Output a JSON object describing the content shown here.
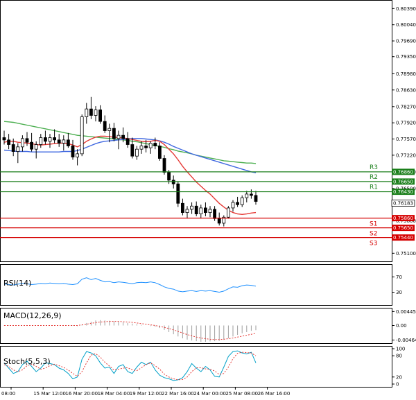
{
  "chart_data": [
    {
      "type": "candlestick",
      "title": "",
      "price_axis_ticks": [
        "0.80390",
        "0.80040",
        "0.79690",
        "0.79350",
        "0.78980",
        "0.78630",
        "0.78270",
        "0.77920",
        "0.77570",
        "0.77220",
        "0.76860",
        "0.76500",
        "0.75800",
        "0.75100"
      ],
      "ylim": [
        0.75,
        0.805
      ],
      "time_axis_labels": [
        "08:00",
        "15 Mar 12:00",
        "16 Mar 20:00",
        "18 Mar 04:00",
        "19 Mar 12:00",
        "22 Mar 16:00",
        "24 Mar 00:00",
        "25 Mar 08:00",
        "26 Mar 16:00"
      ],
      "candles": [
        [
          0.776,
          0.7775,
          0.7745,
          0.7755
        ],
        [
          0.7755,
          0.7768,
          0.7735,
          0.7745
        ],
        [
          0.7745,
          0.7758,
          0.772,
          0.773
        ],
        [
          0.773,
          0.7748,
          0.7705,
          0.774
        ],
        [
          0.774,
          0.7765,
          0.773,
          0.7758
        ],
        [
          0.7758,
          0.7772,
          0.7742,
          0.775
        ],
        [
          0.775,
          0.777,
          0.773,
          0.7735
        ],
        [
          0.7735,
          0.7752,
          0.7715,
          0.7745
        ],
        [
          0.7745,
          0.7768,
          0.7738,
          0.776
        ],
        [
          0.776,
          0.7775,
          0.7745,
          0.7752
        ],
        [
          0.7752,
          0.7768,
          0.7738,
          0.776
        ],
        [
          0.776,
          0.7778,
          0.7748,
          0.7755
        ],
        [
          0.7755,
          0.7768,
          0.774,
          0.7748
        ],
        [
          0.7748,
          0.7765,
          0.7732,
          0.7755
        ],
        [
          0.7755,
          0.777,
          0.7738,
          0.7742
        ],
        [
          0.7742,
          0.7755,
          0.7712,
          0.7718
        ],
        [
          0.7718,
          0.7735,
          0.77,
          0.7725
        ],
        [
          0.7725,
          0.781,
          0.772,
          0.7805
        ],
        [
          0.7805,
          0.7835,
          0.779,
          0.7822
        ],
        [
          0.7822,
          0.7848,
          0.78,
          0.7808
        ],
        [
          0.7808,
          0.7828,
          0.7795,
          0.782
        ],
        [
          0.782,
          0.783,
          0.779,
          0.7795
        ],
        [
          0.7795,
          0.7808,
          0.777,
          0.7775
        ],
        [
          0.7775,
          0.779,
          0.775,
          0.778
        ],
        [
          0.778,
          0.7792,
          0.7752,
          0.7758
        ],
        [
          0.7758,
          0.7775,
          0.7735,
          0.7765
        ],
        [
          0.7765,
          0.7782,
          0.775,
          0.7758
        ],
        [
          0.7758,
          0.7772,
          0.7738,
          0.7745
        ],
        [
          0.7745,
          0.776,
          0.7715,
          0.772
        ],
        [
          0.772,
          0.7742,
          0.7712,
          0.7735
        ],
        [
          0.7735,
          0.7752,
          0.7725,
          0.7742
        ],
        [
          0.7742,
          0.7755,
          0.7728,
          0.7738
        ],
        [
          0.7738,
          0.7752,
          0.7725,
          0.7748
        ],
        [
          0.7748,
          0.776,
          0.7735,
          0.7742
        ],
        [
          0.7742,
          0.775,
          0.771,
          0.7715
        ],
        [
          0.7715,
          0.7722,
          0.768,
          0.7685
        ],
        [
          0.7685,
          0.769,
          0.766,
          0.7668
        ],
        [
          0.7668,
          0.7678,
          0.765,
          0.766
        ],
        [
          0.766,
          0.7665,
          0.761,
          0.7618
        ],
        [
          0.7618,
          0.7628,
          0.7592,
          0.7598
        ],
        [
          0.7598,
          0.7612,
          0.7585,
          0.7605
        ],
        [
          0.7605,
          0.762,
          0.7595,
          0.7612
        ],
        [
          0.7612,
          0.7622,
          0.759,
          0.7595
        ],
        [
          0.7595,
          0.7615,
          0.7585,
          0.7608
        ],
        [
          0.7608,
          0.762,
          0.759,
          0.7598
        ],
        [
          0.7598,
          0.7612,
          0.7588,
          0.7605
        ],
        [
          0.7605,
          0.7612,
          0.758,
          0.7585
        ],
        [
          0.7585,
          0.7598,
          0.757,
          0.7575
        ],
        [
          0.7575,
          0.7592,
          0.7568,
          0.7588
        ],
        [
          0.7588,
          0.7612,
          0.7585,
          0.7608
        ],
        [
          0.7608,
          0.7625,
          0.76,
          0.762
        ],
        [
          0.762,
          0.7632,
          0.761,
          0.7615
        ],
        [
          0.7615,
          0.7635,
          0.761,
          0.763
        ],
        [
          0.763,
          0.7645,
          0.762,
          0.7638
        ],
        [
          0.7638,
          0.7648,
          0.7628,
          0.7635
        ],
        [
          0.7635,
          0.7645,
          0.7615,
          0.7622
        ]
      ],
      "moving_averages": [
        {
          "color": "#4caf50",
          "values": [
            0.7795,
            0.7794,
            0.7793,
            0.7791,
            0.7789,
            0.7787,
            0.7785,
            0.7783,
            0.7781,
            0.7779,
            0.7777,
            0.7775,
            0.7773,
            0.7771,
            0.7769,
            0.7767,
            0.7765,
            0.7764,
            0.7763,
            0.7762,
            0.7761,
            0.776,
            0.7759,
            0.7758,
            0.7757,
            0.7756,
            0.7755,
            0.7754,
            0.7752,
            0.7751,
            0.7749,
            0.7747,
            0.7745,
            0.7743,
            0.7741,
            0.7739,
            0.7736,
            0.7734,
            0.7731,
            0.7729,
            0.7727,
            0.7725,
            0.7722,
            0.772,
            0.7718,
            0.7716,
            0.7714,
            0.7712,
            0.771,
            0.7709,
            0.7708,
            0.7707,
            0.7706,
            0.7705,
            0.7705,
            0.7704
          ]
        },
        {
          "color": "#4169e1",
          "values": [
            0.7733,
            0.7732,
            0.7731,
            0.773,
            0.773,
            0.773,
            0.7729,
            0.7729,
            0.7729,
            0.7729,
            0.7729,
            0.7729,
            0.7729,
            0.773,
            0.773,
            0.773,
            0.7732,
            0.7735,
            0.7739,
            0.7743,
            0.7747,
            0.775,
            0.7752,
            0.7753,
            0.7754,
            0.7755,
            0.7756,
            0.7757,
            0.7758,
            0.7758,
            0.7758,
            0.7757,
            0.7756,
            0.7755,
            0.7753,
            0.775,
            0.7746,
            0.7741,
            0.7737,
            0.7733,
            0.7729,
            0.7725,
            0.7722,
            0.7719,
            0.7716,
            0.7713,
            0.771,
            0.7707,
            0.7704,
            0.7701,
            0.7698,
            0.7695,
            0.7692,
            0.7689,
            0.7686,
            0.7684
          ]
        },
        {
          "color": "#e53935",
          "values": [
            0.775,
            0.7752,
            0.7752,
            0.775,
            0.7749,
            0.7748,
            0.7747,
            0.7745,
            0.7744,
            0.7745,
            0.7746,
            0.7747,
            0.7748,
            0.7748,
            0.7747,
            0.7744,
            0.774,
            0.7745,
            0.7752,
            0.7757,
            0.7761,
            0.7763,
            0.7763,
            0.7762,
            0.7761,
            0.776,
            0.7759,
            0.7758,
            0.7756,
            0.7754,
            0.7752,
            0.7751,
            0.7752,
            0.7754,
            0.7752,
            0.7745,
            0.7735,
            0.7725,
            0.7712,
            0.7698,
            0.7686,
            0.7675,
            0.7664,
            0.7655,
            0.7646,
            0.7638,
            0.7628,
            0.7618,
            0.761,
            0.7603,
            0.7598,
            0.7595,
            0.7594,
            0.7595,
            0.7597,
            0.7598
          ]
        }
      ],
      "current_price": "0.76183"
    },
    {
      "type": "line",
      "name": "RSI(14)",
      "y_axis_ticks": [
        "70",
        "30"
      ],
      "ylim": [
        0,
        100
      ],
      "values": [
        52,
        50,
        49,
        51,
        53,
        52,
        50,
        51,
        53,
        52,
        54,
        53,
        52,
        53,
        51,
        50,
        52,
        64,
        68,
        63,
        66,
        61,
        57,
        58,
        55,
        57,
        56,
        54,
        52,
        55,
        56,
        55,
        57,
        55,
        50,
        44,
        40,
        38,
        33,
        31,
        33,
        34,
        32,
        34,
        33,
        34,
        32,
        30,
        33,
        39,
        44,
        43,
        47,
        49,
        48,
        46
      ]
    },
    {
      "type": "bar+line",
      "name": "MACD(12,26,9)",
      "y_axis_ticks": [
        "0.004451",
        "0.00",
        "-0.004646"
      ],
      "ylim": [
        -0.0052,
        0.0052
      ],
      "histogram": [
        0.0001,
        0.0001,
        0.0,
        0.0,
        0.0,
        0.0,
        0.0,
        0.0,
        0.0,
        0.0,
        0.0,
        0.0,
        0.0,
        0.0,
        0.0,
        -0.0001,
        -0.0002,
        0.0002,
        0.0008,
        0.0012,
        0.0016,
        0.0017,
        0.0016,
        0.0015,
        0.0013,
        0.0011,
        0.001,
        0.0008,
        0.0006,
        0.0004,
        0.0002,
        0.0,
        -0.0002,
        -0.0004,
        -0.0008,
        -0.0014,
        -0.0021,
        -0.0028,
        -0.0035,
        -0.0041,
        -0.0045,
        -0.0048,
        -0.005,
        -0.0052,
        -0.0052,
        -0.0051,
        -0.005,
        -0.0049,
        -0.0046,
        -0.0041,
        -0.0035,
        -0.003,
        -0.0025,
        -0.0021,
        -0.0017,
        -0.0015
      ],
      "signal": [
        0.0,
        0.0,
        0.0,
        0.0,
        0.0,
        0.0,
        0.0,
        0.0,
        0.0,
        0.0,
        0.0,
        0.0,
        0.0,
        0.0,
        0.0,
        0.0,
        0.0,
        0.0002,
        0.0004,
        0.0007,
        0.0009,
        0.0011,
        0.0012,
        0.0013,
        0.0013,
        0.0013,
        0.0012,
        0.0011,
        0.001,
        0.0008,
        0.0006,
        0.0004,
        0.0002,
        0.0,
        -0.0003,
        -0.0006,
        -0.001,
        -0.0014,
        -0.0019,
        -0.0024,
        -0.0029,
        -0.0033,
        -0.0037,
        -0.004,
        -0.0042,
        -0.0044,
        -0.0045,
        -0.0045,
        -0.0044,
        -0.0042,
        -0.004,
        -0.0037,
        -0.0034,
        -0.0031,
        -0.0028,
        -0.0025
      ]
    },
    {
      "type": "line",
      "name": "Stoch(5,5,3)",
      "y_axis_ticks": [
        "100",
        "80",
        "20",
        "0"
      ],
      "ylim": [
        0,
        100
      ],
      "series": [
        {
          "color": "#00a0c8",
          "values": [
            60,
            45,
            30,
            35,
            55,
            65,
            50,
            35,
            45,
            60,
            58,
            55,
            45,
            40,
            30,
            15,
            20,
            70,
            92,
            88,
            80,
            60,
            45,
            48,
            30,
            50,
            55,
            35,
            30,
            48,
            62,
            55,
            62,
            40,
            25,
            18,
            15,
            10,
            12,
            18,
            35,
            58,
            45,
            35,
            50,
            40,
            22,
            20,
            48,
            78,
            92,
            94,
            88,
            85,
            90,
            60
          ]
        },
        {
          "color": "#e53935",
          "values": [
            55,
            50,
            40,
            35,
            40,
            52,
            56,
            50,
            42,
            45,
            52,
            56,
            52,
            47,
            40,
            30,
            22,
            35,
            60,
            82,
            86,
            76,
            62,
            51,
            40,
            42,
            45,
            46,
            40,
            38,
            46,
            55,
            60,
            52,
            42,
            28,
            20,
            15,
            12,
            13,
            20,
            35,
            46,
            46,
            43,
            42,
            37,
            27,
            30,
            48,
            72,
            87,
            90,
            89,
            88,
            80
          ]
        }
      ]
    }
  ],
  "price_levels": [
    {
      "label": "R3",
      "price": "0.76860",
      "color": "#1b7f1b",
      "value": 0.7686
    },
    {
      "label": "R2",
      "price": "0.76650",
      "color": "#1b7f1b",
      "value": 0.7665
    },
    {
      "label": "R1",
      "price": "0.76430",
      "color": "#1b7f1b",
      "value": 0.7643
    },
    {
      "label": "S1",
      "price": "0.75860",
      "color": "#d50000",
      "value": 0.7586
    },
    {
      "label": "S2",
      "price": "0.75650",
      "color": "#d50000",
      "value": 0.7565
    },
    {
      "label": "S3",
      "price": "0.75440",
      "color": "#d50000",
      "value": 0.7544
    }
  ],
  "colors": {
    "bull_candle": "#1b7f1b",
    "bear_candle": "#d50000",
    "price_tag": "#ffffff",
    "grid": "#000000"
  }
}
